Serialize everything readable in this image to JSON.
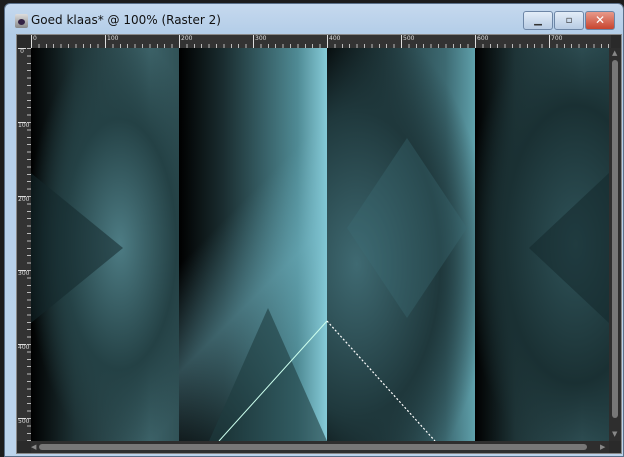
{
  "window": {
    "title": "Goed klaas* @ 100% (Raster 2)",
    "buttons": {
      "minimize": "▁",
      "maximize": "▫",
      "close": "✕"
    }
  },
  "ruler_top": {
    "labels": [
      "0",
      "100",
      "200",
      "300",
      "400",
      "500",
      "600",
      "700"
    ]
  },
  "ruler_left": {
    "labels": [
      "0",
      "100",
      "200",
      "300",
      "400",
      "500"
    ]
  }
}
